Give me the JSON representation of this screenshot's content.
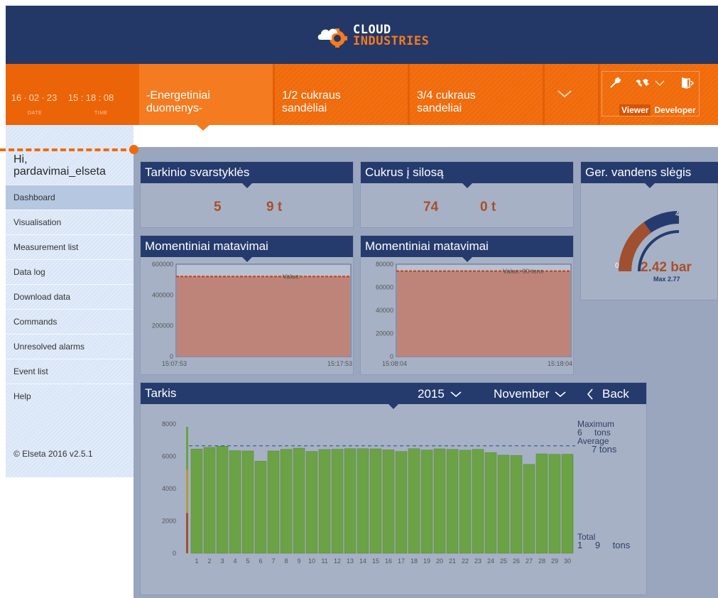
{
  "header": {
    "logo_line1": "CLOUD",
    "logo_line2": "INDUSTRIES"
  },
  "clock": {
    "d1": "16",
    "d2": "02",
    "d3": "23",
    "t1": "15",
    "t2": "18",
    "t3": "08",
    "date_label": "DATE",
    "time_label": "TIME"
  },
  "nav": {
    "tab1_line1": "-Energetiniai",
    "tab1_line2": "duomenys-",
    "tab2_line1": "1/2 cukraus",
    "tab2_line2": "sandėliai",
    "tab3_line1": "3/4 cukraus",
    "tab3_line2": "sandeliai"
  },
  "tools": {
    "viewer": "Viewer",
    "developer": "Developer"
  },
  "sidebar": {
    "greeting_line1": "Hi,",
    "greeting_line2": "pardavimai_elseta",
    "items": [
      "Dashboard",
      "Visualisation",
      "Measurement list",
      "Data log",
      "Download data",
      "Commands",
      "Unresolved alarms",
      "Event list",
      "Help"
    ],
    "copyright": "© Elseta 2016 v2.5.1"
  },
  "widgets": {
    "w1": {
      "title": "Tarkinio svarstyklės",
      "v1": "5",
      "v2": "9 t"
    },
    "w2": {
      "title": "Cukrus į silosą",
      "v1": "74",
      "v2": "0 t"
    },
    "w3": {
      "title": "Ger. vandens slėgis",
      "value": "2.42 bar",
      "max": "Max 2.77",
      "min_tick": "0",
      "max_tick": "4",
      "level": 2.42,
      "range": [
        0,
        4
      ]
    },
    "w4": {
      "title": "Momentiniai matavimai"
    },
    "w5": {
      "title": "Momentiniai matavimai"
    }
  },
  "tarkis": {
    "title": "Tarkis",
    "year": "2015",
    "month": "November",
    "back": "Back",
    "max_label": "Maximum",
    "max_value": "6 tons",
    "avg_label": "Average",
    "avg_value": "7 tons",
    "total_label": "Total",
    "total_value": "1 9 tons"
  },
  "chart_data": [
    {
      "type": "area",
      "x": [
        "15:07:53",
        "15:17:53"
      ],
      "values": [
        520000,
        520000
      ],
      "ylim": [
        0,
        600000
      ],
      "yticks": [
        "600000",
        "400000",
        "200000",
        "0"
      ],
      "annotation": "Value:",
      "colors": {
        "fill": "#bf8479",
        "line": "#c0502a"
      }
    },
    {
      "type": "area",
      "x": [
        "15:08:04",
        "15:18:04"
      ],
      "values": [
        74000,
        74000
      ],
      "ylim": [
        0,
        80000
      ],
      "yticks": [
        "80000",
        "60000",
        "40000",
        "20000",
        "0"
      ],
      "annotation": "Value:",
      "annotation_value": "90 tons",
      "colors": {
        "fill": "#bf8479",
        "line": "#c0502a"
      }
    },
    {
      "type": "bar",
      "categories": [
        "1",
        "2",
        "3",
        "4",
        "5",
        "6",
        "7",
        "8",
        "9",
        "10",
        "11",
        "12",
        "13",
        "14",
        "15",
        "16",
        "17",
        "18",
        "19",
        "20",
        "21",
        "22",
        "23",
        "24",
        "25",
        "26",
        "27",
        "28",
        "29",
        "30"
      ],
      "values": [
        6450,
        6550,
        6620,
        6350,
        6330,
        5700,
        6330,
        6430,
        6500,
        6300,
        6420,
        6440,
        6470,
        6470,
        6460,
        6400,
        6300,
        6470,
        6390,
        6460,
        6430,
        6380,
        6430,
        6230,
        6070,
        6050,
        5500,
        6150,
        6120,
        6130
      ],
      "ylim": [
        0,
        8000
      ],
      "yticks": [
        "8000",
        "6000",
        "4000",
        "2000",
        "0"
      ],
      "reference_line": 6650,
      "colors": {
        "bar": "#6ca246",
        "bar_edge": "#5a8a38",
        "ref": "#2f4a86"
      }
    }
  ]
}
